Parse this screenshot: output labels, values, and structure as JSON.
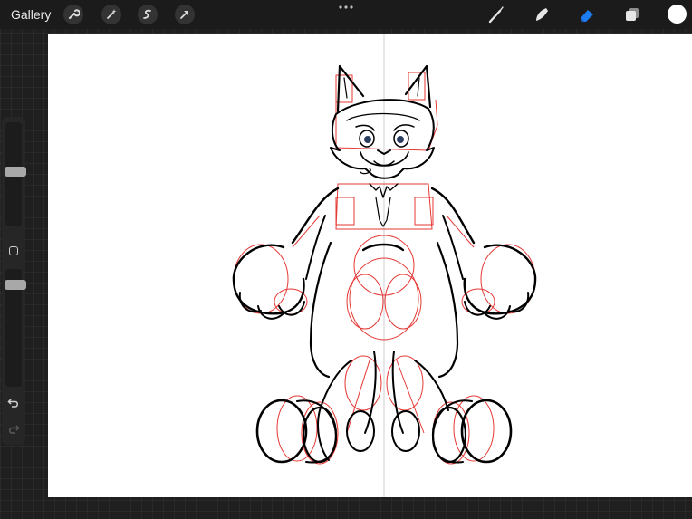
{
  "toolbar": {
    "gallery_label": "Gallery",
    "left_tools": [
      "wrench-icon",
      "magic-wand-icon",
      "selection-icon",
      "transform-arrow-icon"
    ],
    "right_tools": [
      "brush-icon",
      "smudge-icon",
      "eraser-icon",
      "layers-icon"
    ],
    "active_tool": "eraser-icon",
    "current_color": "#ffffff",
    "accent_color": "#1e7cf2"
  },
  "sidebar": {
    "brush_size_level": 0.5,
    "opacity_level": 0.1,
    "buttons": [
      "modifier-square-icon",
      "undo-icon",
      "redo-icon"
    ]
  },
  "canvas": {
    "background": "#ffffff",
    "sketch_colors": {
      "lineart": "#000000",
      "construction": "#e53935",
      "guide": "#bdbdbd"
    }
  }
}
